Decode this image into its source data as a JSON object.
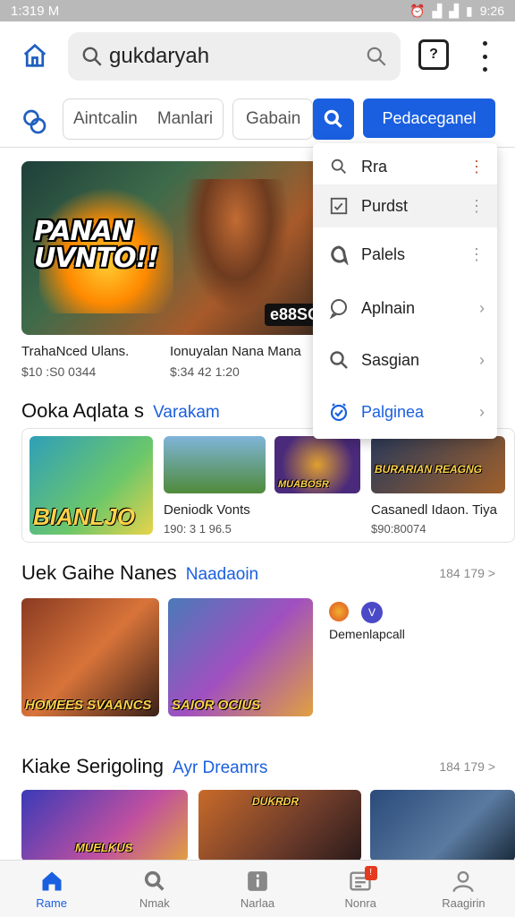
{
  "status_bar": {
    "left": "1:319 M",
    "right": "9:26"
  },
  "search": {
    "query": "gukdaryah"
  },
  "filters": {
    "chip_a": "Aintcalin",
    "chip_b": "Manlari",
    "chip_c": "Gabain",
    "primary_button": "Pedaceganel"
  },
  "hero": {
    "logo_text": "PANAN\nUVNTO!!",
    "badge": "e88SO",
    "captions": [
      {
        "title": "TrahaNced Ulans.",
        "sub": "$10 :S0 0344"
      },
      {
        "title": "Ionuyalan Nana Mana",
        "sub": "$:34 42 1:20"
      }
    ]
  },
  "dropdown": {
    "items": [
      {
        "label": "Rra",
        "icon": "search-icon",
        "trail": "⋮"
      },
      {
        "label": "Purdst",
        "icon": "checkbox-icon",
        "trail": "⋮"
      },
      {
        "label": "Palels",
        "icon": "chat-icon",
        "trail": "⋮"
      },
      {
        "label": "Aplnain",
        "icon": "chat-bubble-icon",
        "trail": "›"
      },
      {
        "label": "Sasgian",
        "icon": "search-icon",
        "trail": "›"
      },
      {
        "label": "Palginea",
        "icon": "clock-check-icon",
        "trail": "›"
      }
    ]
  },
  "section1": {
    "title": "Ooka Aqlata s",
    "link": "Varakam",
    "cards": [
      {
        "label": "BIANLJO"
      },
      {
        "title": "Deniodk Vonts",
        "sub": "190: 3 1 96.5"
      },
      {
        "label": "MUABOSR"
      },
      {
        "label": "BURARIAN REAGNG",
        "title": "Casanedl Idaon. Tiya",
        "sub": "$90:80074"
      }
    ]
  },
  "section2": {
    "title": "Uek Gaihe Nanes",
    "link": "Naadaoin",
    "more": "184 179 >",
    "cards": [
      {
        "label": "HOMEES SVAANCS"
      },
      {
        "label": "SAIOR OCIUS"
      }
    ],
    "side_text": "Demenlapcall"
  },
  "section3": {
    "title": "Kiake Serigoling",
    "link": "Ayr Dreamrs",
    "more": "184 179 >",
    "cards": [
      {
        "label": "MUELKUS"
      },
      {
        "label": "DUKRDR"
      },
      {
        "label": ""
      }
    ]
  },
  "bottom_nav": {
    "items": [
      {
        "label": "Rame",
        "icon": "home-icon"
      },
      {
        "label": "Nmak",
        "icon": "search-icon"
      },
      {
        "label": "Narlaa",
        "icon": "info-icon"
      },
      {
        "label": "Nonra",
        "icon": "list-icon",
        "badge": "!"
      },
      {
        "label": "Raagirin",
        "icon": "profile-icon"
      }
    ]
  },
  "colors": {
    "accent": "#1a5fe0",
    "badge_red": "#e53a1f"
  }
}
